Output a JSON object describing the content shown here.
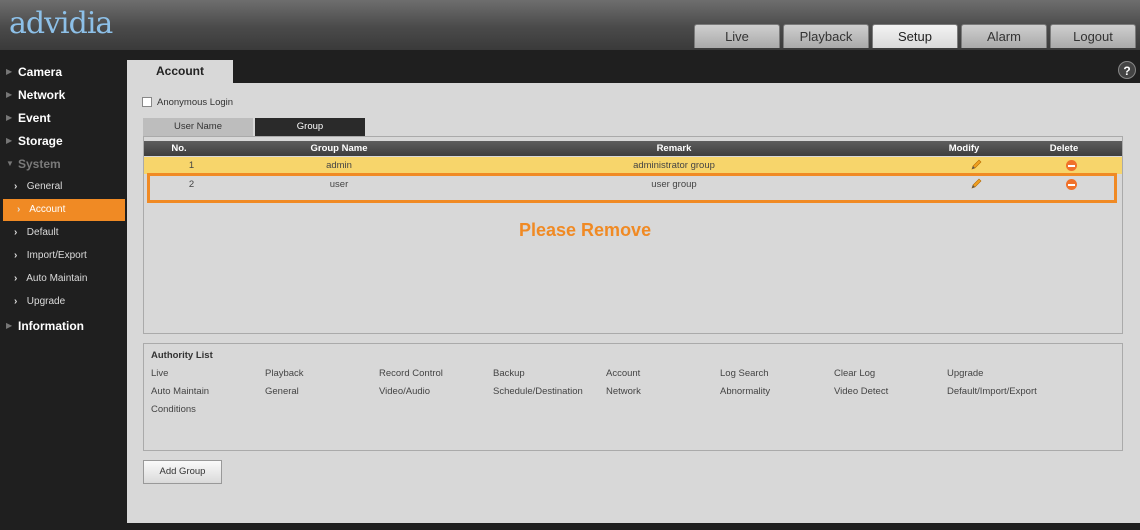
{
  "brand": {
    "logo": "advidia"
  },
  "nav": {
    "tabs": [
      {
        "label": "Live",
        "active": false
      },
      {
        "label": "Playback",
        "active": false
      },
      {
        "label": "Setup",
        "active": true
      },
      {
        "label": "Alarm",
        "active": false
      },
      {
        "label": "Logout",
        "active": false
      }
    ]
  },
  "sidebar": {
    "items": [
      {
        "label": "Camera",
        "type": "main"
      },
      {
        "label": "Network",
        "type": "main"
      },
      {
        "label": "Event",
        "type": "main"
      },
      {
        "label": "Storage",
        "type": "main"
      },
      {
        "label": "System",
        "type": "main",
        "expanded": true
      },
      {
        "label": "General",
        "type": "sub"
      },
      {
        "label": "Account",
        "type": "sub",
        "active": true
      },
      {
        "label": "Default",
        "type": "sub"
      },
      {
        "label": "Import/Export",
        "type": "sub"
      },
      {
        "label": "Auto Maintain",
        "type": "sub"
      },
      {
        "label": "Upgrade",
        "type": "sub"
      },
      {
        "label": "Information",
        "type": "main"
      }
    ]
  },
  "page": {
    "tab_label": "Account",
    "help": "?",
    "anonymous_login": {
      "label": "Anonymous Login",
      "checked": false
    },
    "subtabs": [
      {
        "label": "User Name",
        "active": false
      },
      {
        "label": "Group",
        "active": true
      }
    ]
  },
  "table": {
    "headers": [
      "No.",
      "Group Name",
      "Remark",
      "Modify",
      "Delete"
    ],
    "rows": [
      {
        "no": "1",
        "group_name": "admin",
        "remark": "administrator group",
        "selected": true
      },
      {
        "no": "2",
        "group_name": "user",
        "remark": "user group",
        "selected": false
      }
    ]
  },
  "annotation": {
    "text": "Please Remove",
    "color": "#f08a24"
  },
  "authority": {
    "title": "Authority List",
    "rows": [
      [
        "Live",
        "Playback",
        "Record Control",
        "Backup",
        "Account",
        "Log Search",
        "Clear Log",
        "Upgrade"
      ],
      [
        "Auto Maintain",
        "General",
        "Video/Audio",
        "Schedule/Destination",
        "Network",
        "Abnormality",
        "Video Detect",
        "Default/Import/Export"
      ],
      [
        "Conditions"
      ]
    ]
  },
  "buttons": {
    "add_group": "Add Group"
  },
  "colors": {
    "accent": "#f08a24",
    "selected_row": "#f7d56b",
    "logo": "#8dc0e8"
  }
}
